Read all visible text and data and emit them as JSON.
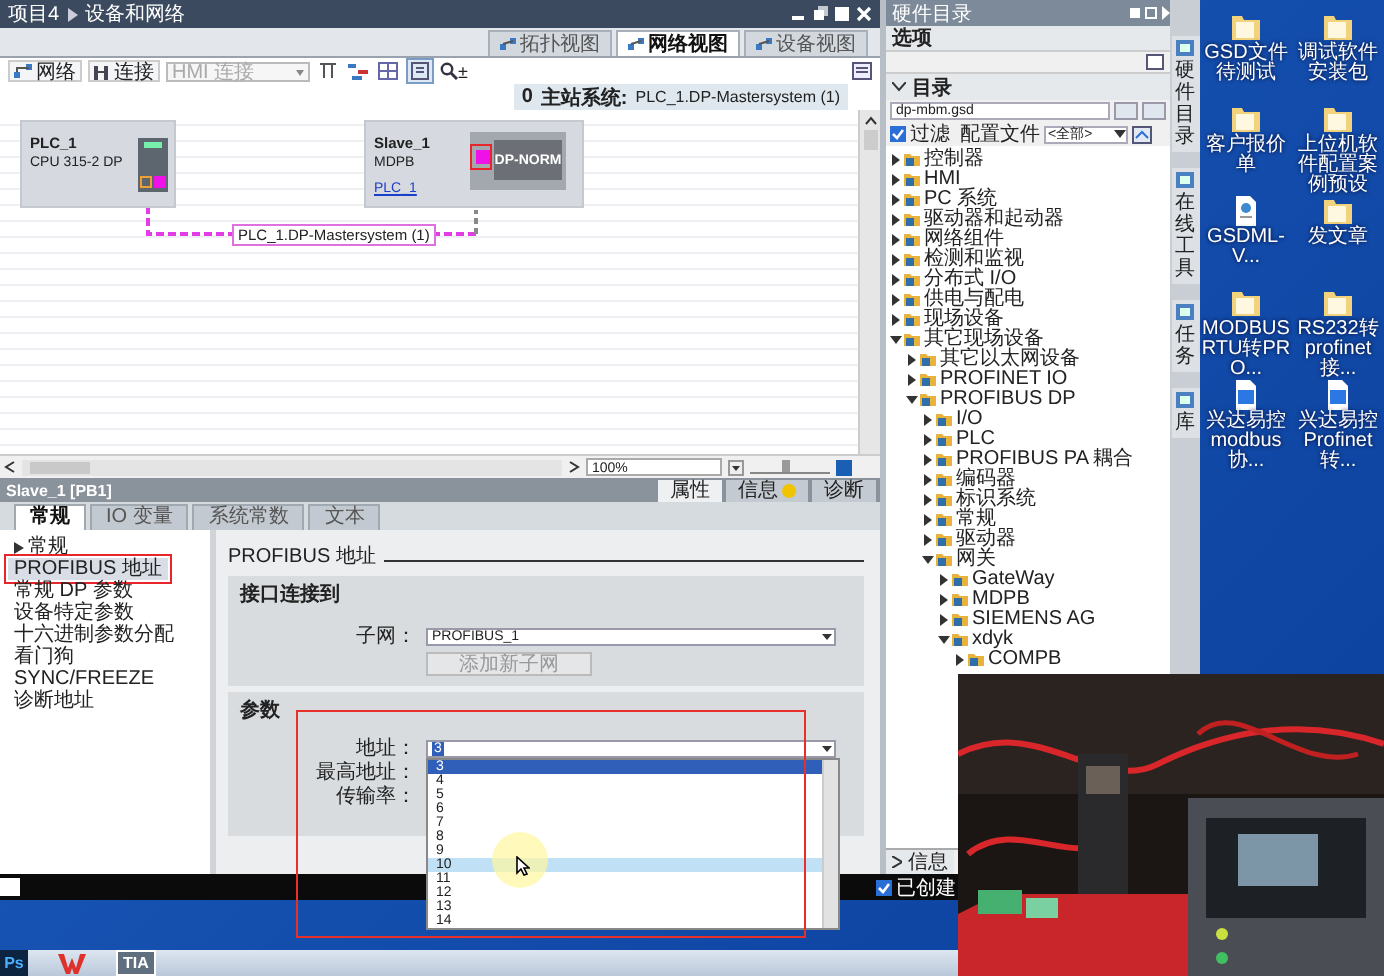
{
  "editor": {
    "breadcrumb": [
      "项目4",
      "设备和网络"
    ],
    "view_tabs": [
      {
        "label": "拓扑视图",
        "selected": false
      },
      {
        "label": "网络视图",
        "selected": true
      },
      {
        "label": "设备视图",
        "selected": false
      }
    ],
    "toolbar": {
      "network": "网络",
      "connections": "连接",
      "connection_type": {
        "value": "HMI 连接",
        "disabled": true
      },
      "zoom_mark": "±"
    },
    "master_system": {
      "number": "0",
      "label": "主站系统:",
      "value": "PLC_1.DP-Mastersystem (1)"
    },
    "devices": [
      {
        "kind": "plc",
        "name": "PLC_1",
        "type": "CPU 315-2 DP"
      },
      {
        "kind": "slave",
        "name": "Slave_1",
        "type": "MDPB",
        "master_link": "PLC_1",
        "module": "DP-NORM",
        "port_highlighted": true
      }
    ],
    "bus_label": "PLC_1.DP-Mastersystem (1)",
    "zoom_value": "100%",
    "zoom_slider": {
      "level": 0.45
    }
  },
  "inspector": {
    "title": "Slave_1 [PB1]",
    "tabs": [
      {
        "label": "属性",
        "selected": true,
        "alert": false
      },
      {
        "label": "信息",
        "selected": false,
        "alert": true
      },
      {
        "label": "诊断",
        "selected": false,
        "alert": false
      }
    ],
    "sub_tabs": [
      {
        "label": "常规",
        "selected": true
      },
      {
        "label": "IO 变量",
        "selected": false
      },
      {
        "label": "系统常数",
        "selected": false
      },
      {
        "label": "文本",
        "selected": false
      }
    ],
    "nav": [
      {
        "label": "常规",
        "kind": "group",
        "selected": false,
        "highlighted": false
      },
      {
        "label": "PROFIBUS 地址",
        "kind": "page",
        "selected": true,
        "highlighted": true
      },
      {
        "label": "常规 DP 参数",
        "kind": "page",
        "selected": false,
        "highlighted": false
      },
      {
        "label": "设备特定参数",
        "kind": "page",
        "selected": false,
        "highlighted": false
      },
      {
        "label": "十六进制参数分配",
        "kind": "page",
        "selected": false,
        "highlighted": false
      },
      {
        "label": "看门狗",
        "kind": "page",
        "selected": false,
        "highlighted": false
      },
      {
        "label": "SYNC/FREEZE",
        "kind": "page",
        "selected": false,
        "highlighted": false
      },
      {
        "label": "诊断地址",
        "kind": "page",
        "selected": false,
        "highlighted": false
      }
    ],
    "section_title": "PROFIBUS 地址",
    "interface": {
      "title": "接口连接到",
      "subnet_label": "子网：",
      "subnet": "PROFIBUS_1",
      "add_button": "添加新子网"
    },
    "parameters": {
      "title": "参数",
      "highlighted": true,
      "address": "3",
      "fields": [
        {
          "label": "地址："
        },
        {
          "label": "最高地址："
        },
        {
          "label": "传输率："
        }
      ],
      "options": [
        {
          "label": "3",
          "selected": true,
          "hovered": false
        },
        {
          "label": "4",
          "selected": false,
          "hovered": false
        },
        {
          "label": "5",
          "selected": false,
          "hovered": false
        },
        {
          "label": "6",
          "selected": false,
          "hovered": false
        },
        {
          "label": "7",
          "selected": false,
          "hovered": false
        },
        {
          "label": "8",
          "selected": false,
          "hovered": false
        },
        {
          "label": "9",
          "selected": false,
          "hovered": false
        },
        {
          "label": "10",
          "selected": false,
          "hovered": true
        },
        {
          "label": "11",
          "selected": false,
          "hovered": false
        },
        {
          "label": "12",
          "selected": false,
          "hovered": false
        },
        {
          "label": "13",
          "selected": false,
          "hovered": false
        },
        {
          "label": "14",
          "selected": false,
          "hovered": false
        }
      ]
    }
  },
  "catalog": {
    "title": "硬件目录",
    "options_label": "选项",
    "catalog_label": "目录",
    "search": "dp-mbm.gsd",
    "filter": {
      "label": "过滤",
      "checked": true
    },
    "profile_label": "配置文件",
    "profile": "<全部>",
    "tree": [
      {
        "label": "控制器",
        "expanded": false
      },
      {
        "label": "HMI",
        "expanded": false
      },
      {
        "label": "PC 系统",
        "expanded": false
      },
      {
        "label": "驱动器和起动器",
        "expanded": false
      },
      {
        "label": "网络组件",
        "expanded": false
      },
      {
        "label": "检测和监视",
        "expanded": false
      },
      {
        "label": "分布式 I/O",
        "expanded": false
      },
      {
        "label": "供电与配电",
        "expanded": false
      },
      {
        "label": "现场设备",
        "expanded": false
      },
      {
        "label": "其它现场设备",
        "expanded": true,
        "children": [
          {
            "label": "其它以太网设备",
            "expanded": false
          },
          {
            "label": "PROFINET IO",
            "expanded": false
          },
          {
            "label": "PROFIBUS DP",
            "expanded": true,
            "children": [
              {
                "label": "I/O",
                "expanded": false
              },
              {
                "label": "PLC",
                "expanded": false
              },
              {
                "label": "PROFIBUS PA 耦合",
                "expanded": false
              },
              {
                "label": "编码器",
                "expanded": false
              },
              {
                "label": "标识系统",
                "expanded": false
              },
              {
                "label": "常规",
                "expanded": false
              },
              {
                "label": "驱动器",
                "expanded": false
              },
              {
                "label": "网关",
                "expanded": true,
                "children": [
                  {
                    "label": "GateWay",
                    "expanded": false
                  },
                  {
                    "label": "MDPB",
                    "expanded": false
                  },
                  {
                    "label": "SIEMENS AG",
                    "expanded": false
                  },
                  {
                    "label": "xdyk",
                    "expanded": true,
                    "children": [
                      {
                        "label": "COMPB",
                        "expanded": false
                      }
                    ]
                  }
                ]
              }
            ]
          }
        ]
      }
    ],
    "info_tab": "信息",
    "side_tabs": [
      "硬件目录",
      "在线工具",
      "任务",
      "库"
    ]
  },
  "status": {
    "text": "已创建"
  },
  "desktop_icons": [
    {
      "kind": "folder",
      "label": "GSD文件待测试"
    },
    {
      "kind": "folder",
      "label": "调试软件安装包"
    },
    {
      "kind": "folder",
      "label": "客户报价单"
    },
    {
      "kind": "folder",
      "label": "上位机软件配置案例预设"
    },
    {
      "kind": "file",
      "label": "GSDML-V..."
    },
    {
      "kind": "folder",
      "label": "发文章"
    },
    {
      "kind": "folder",
      "label": "MODBUS RTU转PRO..."
    },
    {
      "kind": "folder",
      "label": "RS232转 profinet接..."
    },
    {
      "kind": "doc",
      "label": "兴达易控 modbus协..."
    },
    {
      "kind": "doc",
      "label": "兴达易控 Profinet 转..."
    }
  ],
  "taskbar": [
    {
      "kind": "ps",
      "label": "Ps"
    },
    {
      "kind": "wps"
    },
    {
      "kind": "tia",
      "label": "TIA"
    }
  ]
}
